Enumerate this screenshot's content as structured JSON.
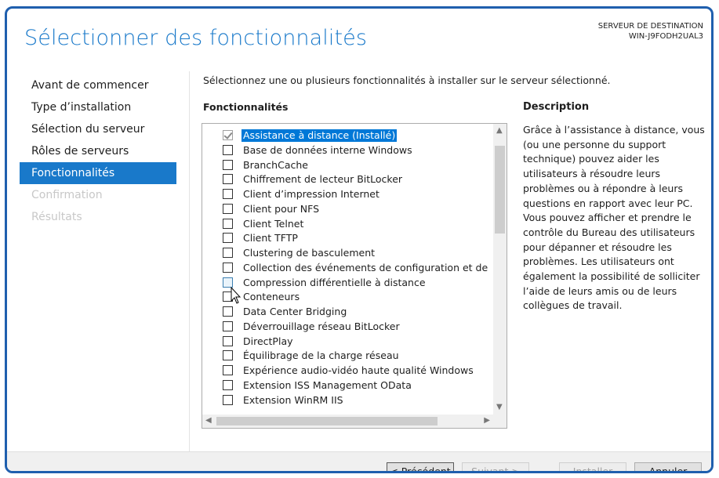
{
  "window": {
    "title": "Sélectionner des fonctionnalités",
    "destination_label": "SERVEUR DE DESTINATION",
    "destination_server": "WIN-J9FODH2UAL3"
  },
  "steps": [
    {
      "label": "Avant de commencer",
      "state": "normal"
    },
    {
      "label": "Type d’installation",
      "state": "normal"
    },
    {
      "label": "Sélection du serveur",
      "state": "normal"
    },
    {
      "label": "Rôles de serveurs",
      "state": "normal"
    },
    {
      "label": "Fonctionnalités",
      "state": "active"
    },
    {
      "label": "Confirmation",
      "state": "disabled"
    },
    {
      "label": "Résultats",
      "state": "disabled"
    }
  ],
  "main": {
    "instruction": "Sélectionnez une ou plusieurs fonctionnalités à installer sur le serveur sélectionné.",
    "features_header": "Fonctionnalités",
    "description_header": "Description",
    "description_text": "Grâce à l’assistance à distance, vous (ou une personne du support technique) pouvez aider les utilisateurs à résoudre leurs problèmes ou à répondre à leurs questions en rapport avec leur PC. Vous pouvez afficher et prendre le contrôle du Bureau des utilisateurs pour dépanner et résoudre les problèmes. Les utilisateurs ont également la possibilité de solliciter l’aide de leurs amis ou de leurs collègues de travail."
  },
  "features": [
    {
      "label": "Assistance à distance (Installé)",
      "checked": true,
      "selected": true
    },
    {
      "label": "Base de données interne Windows",
      "checked": false
    },
    {
      "label": "BranchCache",
      "checked": false
    },
    {
      "label": "Chiffrement de lecteur BitLocker",
      "checked": false
    },
    {
      "label": "Client d’impression Internet",
      "checked": false
    },
    {
      "label": "Client pour NFS",
      "checked": false
    },
    {
      "label": "Client Telnet",
      "checked": false
    },
    {
      "label": "Client TFTP",
      "checked": false
    },
    {
      "label": "Clustering de basculement",
      "checked": false
    },
    {
      "label": "Collection des événements de configuration et de",
      "checked": false
    },
    {
      "label": "Compression différentielle à distance",
      "checked": false,
      "hover": true
    },
    {
      "label": "Conteneurs",
      "checked": false
    },
    {
      "label": "Data Center Bridging",
      "checked": false
    },
    {
      "label": "Déverrouillage réseau BitLocker",
      "checked": false
    },
    {
      "label": "DirectPlay",
      "checked": false
    },
    {
      "label": "Équilibrage de la charge réseau",
      "checked": false
    },
    {
      "label": "Expérience audio-vidéo haute qualité Windows",
      "checked": false
    },
    {
      "label": "Extension ISS Management OData",
      "checked": false
    },
    {
      "label": "Extension WinRM IIS",
      "checked": false
    }
  ],
  "scroll_icons": {
    "up": "▲",
    "down": "▼",
    "left": "◀",
    "right": "▶"
  },
  "buttons": {
    "previous": "< Précédent",
    "next": "Suivant >",
    "install": "Installer",
    "cancel": "Annuler"
  },
  "colors": {
    "accent": "#1979ca",
    "selection": "#0078d7"
  }
}
